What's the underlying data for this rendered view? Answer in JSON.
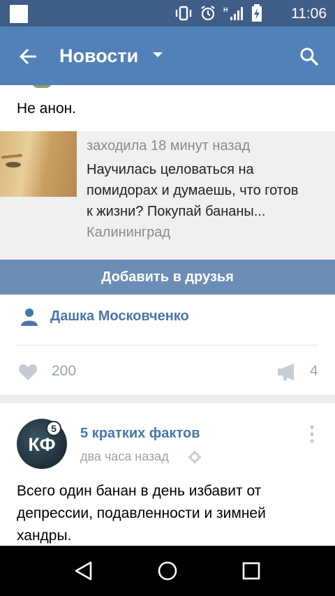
{
  "status_bar": {
    "time": "11:06",
    "icons": [
      "vibrate-icon",
      "alarm-icon",
      "signal-icon",
      "battery-charging-icon"
    ]
  },
  "toolbar": {
    "title": "Новости",
    "icons": [
      "back-arrow-icon",
      "dropdown-caret-icon",
      "search-icon"
    ]
  },
  "post1": {
    "text": "Не анон.",
    "ad": {
      "last_seen": "заходила 18 минут назад",
      "body_lines": [
        "Научилась целоваться на",
        "помидорах и думаешь, что готов",
        "к жизни? Покупай бананы..."
      ],
      "city": "Калининград",
      "button_label": "Добавить в друзья"
    },
    "author": "Дашка Московченко",
    "likes": "200",
    "shares": "4"
  },
  "post2": {
    "group_name": "5 кратких фактов",
    "logo_text": "КФ",
    "logo_badge": "5",
    "time": "два часа назад",
    "text_lines": [
      "Всего один банан в день избавит от",
      "депрессии, подавленности и зимней",
      "хандры."
    ]
  },
  "navigation": {
    "icons": [
      "back-triangle-icon",
      "home-circle-icon",
      "recents-square-icon"
    ]
  },
  "colors": {
    "toolbar": "#5181b8",
    "status_bar": "#3f5e87",
    "link": "#4a76a8",
    "button": "#6b8db6"
  }
}
